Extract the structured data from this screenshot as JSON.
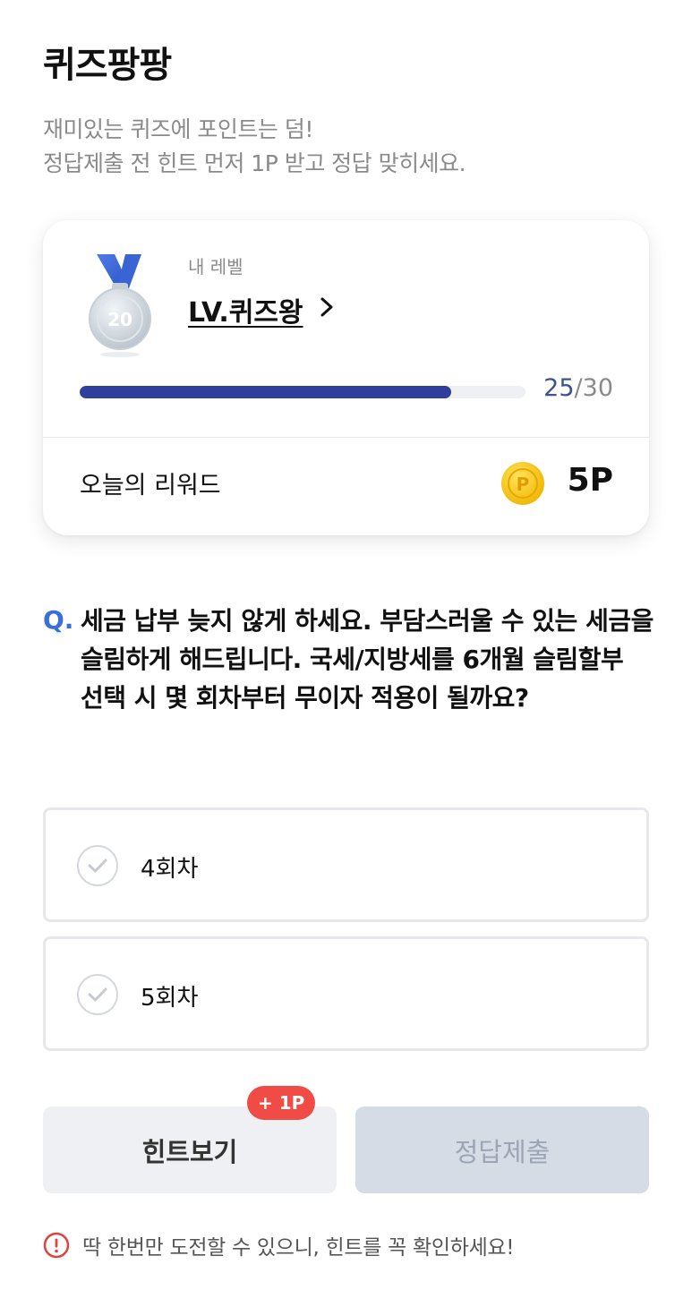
{
  "header": {
    "title": "퀴즈팡팡",
    "description_line1": "재미있는 퀴즈에 포인트는 덤!",
    "description_line2": "정답제출 전 힌트 먼저 1P 받고 정답 맞히세요."
  },
  "level_card": {
    "medal_number": "20",
    "caption": "내 레벨",
    "level_name": "LV.퀴즈왕",
    "progress_current": "25",
    "progress_separator": "/",
    "progress_total": "30",
    "progress_fraction": 0.833,
    "reward_label": "오늘의 리워드",
    "reward_value": "5P",
    "coin_letter": "P"
  },
  "question": {
    "prefix": "Q.",
    "text": "세금 납부 늦지 않게 하세요. 부담스러울 수 있는 세금을 슬림하게 해드립니다. 국세/지방세를 6개월 슬림할부 선택 시 몇 회차부터 무이자 적용이 될까요?"
  },
  "options": [
    {
      "label": "4회차"
    },
    {
      "label": "5회차"
    }
  ],
  "actions": {
    "hint_label": "힌트보기",
    "hint_badge": "+ 1P",
    "submit_label": "정답제출"
  },
  "notice": {
    "text": "딱 한번만 도전할 수 있으니, 힌트를 꼭 확인하세요!"
  },
  "colors": {
    "accent_blue": "#2f3f9c",
    "question_mark": "#3a6fd8",
    "badge_red": "#f04b44",
    "coin_gold": "#f5c518"
  }
}
